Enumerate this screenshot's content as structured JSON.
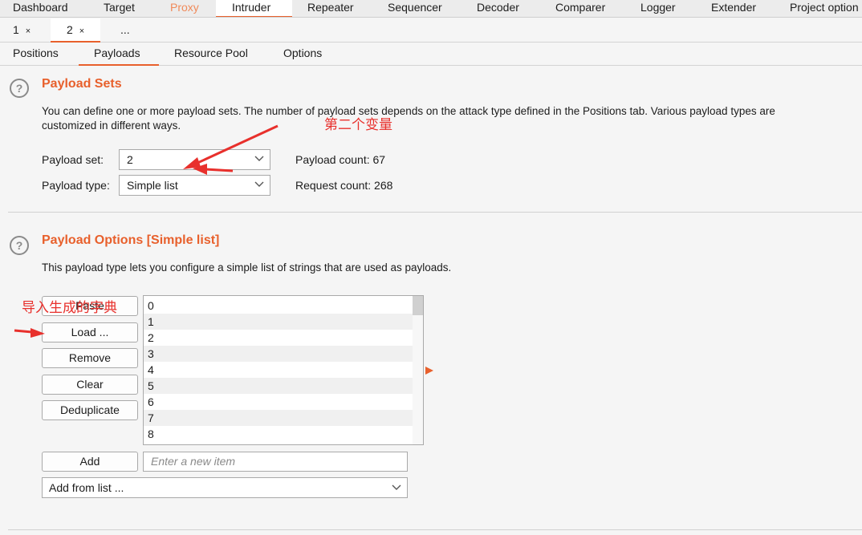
{
  "topnav": {
    "tabs": [
      "Dashboard",
      "Target",
      "Proxy",
      "Intruder",
      "Repeater",
      "Sequencer",
      "Decoder",
      "Comparer",
      "Logger",
      "Extender",
      "Project option"
    ]
  },
  "instance_tabs": {
    "items": [
      "1",
      "2",
      "..."
    ],
    "close_glyph": "×"
  },
  "subtabs": [
    "Positions",
    "Payloads",
    "Resource Pool",
    "Options"
  ],
  "payload_sets": {
    "title": "Payload Sets",
    "description_line1": "You can define one or more payload sets. The number of payload sets depends on the attack type defined in the Positions tab. Various payload types are",
    "description_line2": "customized in different ways.",
    "set_label": "Payload set:",
    "set_value": "2",
    "type_label": "Payload type:",
    "type_value": "Simple list",
    "payload_count": "Payload count: 67",
    "request_count": "Request count: 268"
  },
  "payload_options": {
    "title": "Payload Options [Simple list]",
    "description": "This payload type lets you configure a simple list of strings that are used as payloads.",
    "buttons": {
      "paste": "Paste",
      "load": "Load ...",
      "remove": "Remove",
      "clear": "Clear",
      "deduplicate": "Deduplicate",
      "add": "Add"
    },
    "list_items": [
      "0",
      "1",
      "2",
      "3",
      "4",
      "5",
      "6",
      "7",
      "8"
    ],
    "new_item_placeholder": "Enter a new item",
    "add_from_list": "Add from list ..."
  },
  "annotations": {
    "second_variable": "第二个变量",
    "import_dict": "导入生成的字典"
  },
  "help_glyph": "?",
  "colors": {
    "accent": "#e8602c",
    "annotation": "#e8302c"
  }
}
